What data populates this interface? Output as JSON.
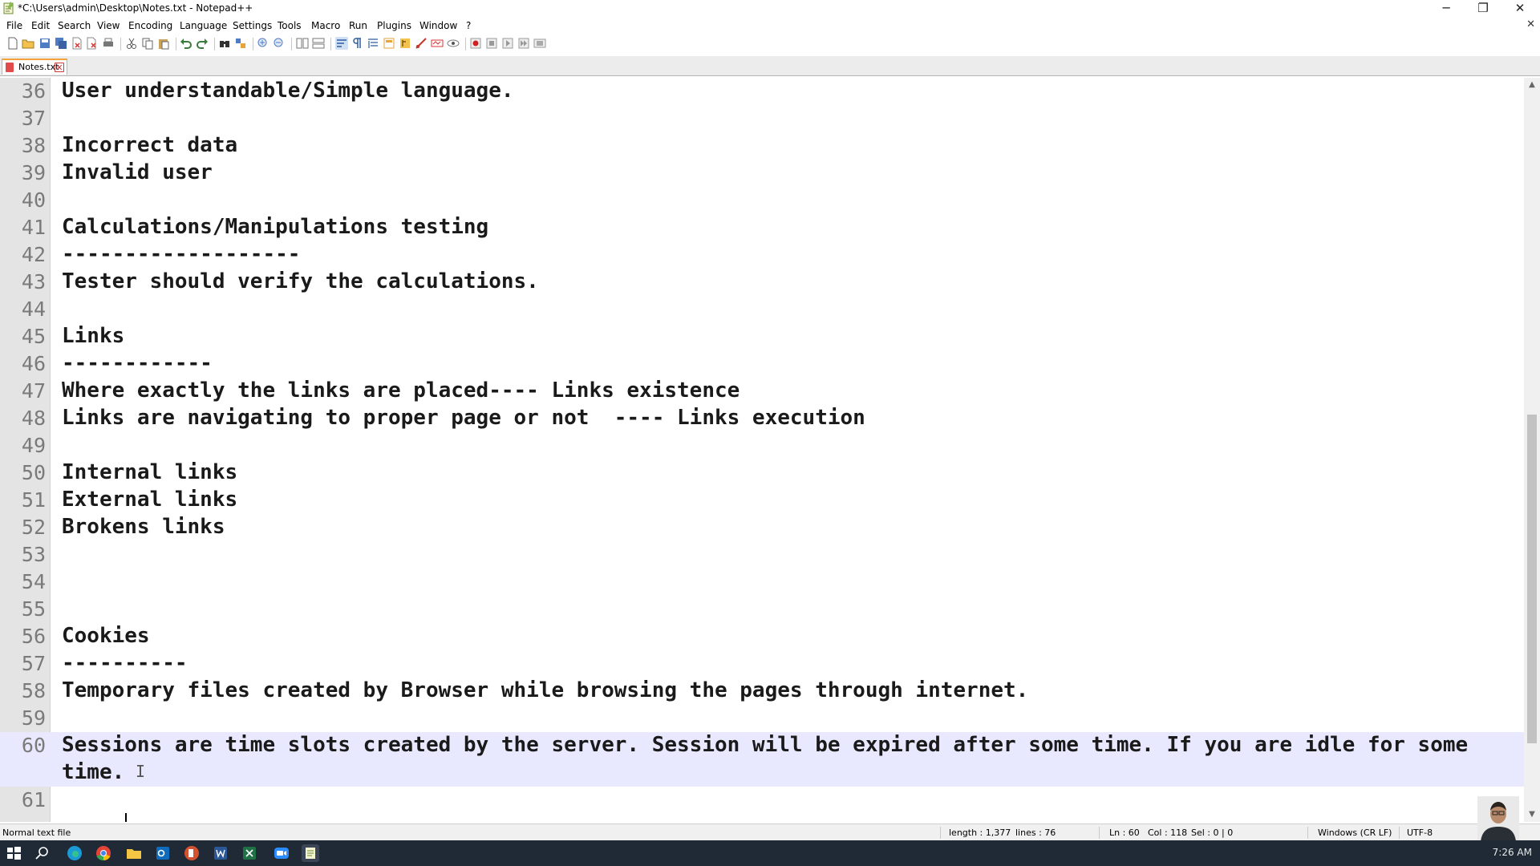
{
  "window": {
    "title": "*C:\\Users\\admin\\Desktop\\Notes.txt - Notepad++",
    "minimize": "─",
    "restore": "❐",
    "close": "✕"
  },
  "menu": {
    "items": [
      "File",
      "Edit",
      "Search",
      "View",
      "Encoding",
      "Language",
      "Settings",
      "Tools",
      "Macro",
      "Run",
      "Plugins",
      "Window",
      "?"
    ],
    "doc_close": "✕"
  },
  "toolbar": {
    "icons": [
      "new-file-icon",
      "open-file-icon",
      "save-icon",
      "save-all-icon",
      "close-icon",
      "close-all-icon",
      "print-icon",
      "cut-icon",
      "copy-icon",
      "paste-icon",
      "undo-icon",
      "redo-icon",
      "find-icon",
      "replace-icon",
      "zoom-in-icon",
      "zoom-out-icon",
      "sync-vertical-icon",
      "sync-horizontal-icon",
      "word-wrap-icon",
      "show-all-chars-icon",
      "indent-guide-icon",
      "doc-map-icon",
      "function-list-icon",
      "folder-workspace-icon",
      "monitoring-icon",
      "record-macro-icon",
      "stop-macro-icon",
      "play-macro-icon",
      "run-macro-multiple-icon",
      "save-macro-icon"
    ]
  },
  "tabs": [
    {
      "label": "Notes.txt",
      "close": "✕"
    }
  ],
  "editor": {
    "lines": [
      {
        "n": "36",
        "text": "User understandable/Simple language."
      },
      {
        "n": "37",
        "text": ""
      },
      {
        "n": "38",
        "text": "Incorrect data"
      },
      {
        "n": "39",
        "text": "Invalid user"
      },
      {
        "n": "40",
        "text": ""
      },
      {
        "n": "41",
        "text": "Calculations/Manipulations testing"
      },
      {
        "n": "42",
        "text": "-------------------"
      },
      {
        "n": "43",
        "text": "Tester should verify the calculations."
      },
      {
        "n": "44",
        "text": ""
      },
      {
        "n": "45",
        "text": "Links"
      },
      {
        "n": "46",
        "text": "------------"
      },
      {
        "n": "47",
        "text": "Where exactly the links are placed---- Links existence"
      },
      {
        "n": "48",
        "text": "Links are navigating to proper page or not  ---- Links execution"
      },
      {
        "n": "49",
        "text": ""
      },
      {
        "n": "50",
        "text": "Internal links"
      },
      {
        "n": "51",
        "text": "External links"
      },
      {
        "n": "52",
        "text": "Brokens links"
      },
      {
        "n": "53",
        "text": ""
      },
      {
        "n": "54",
        "text": ""
      },
      {
        "n": "55",
        "text": ""
      },
      {
        "n": "56",
        "text": "Cookies"
      },
      {
        "n": "57",
        "text": "----------"
      },
      {
        "n": "58",
        "text": "Temporary files created by Browser while browsing the pages through internet."
      },
      {
        "n": "59",
        "text": ""
      },
      {
        "n": "60",
        "text": "Sessions are time slots created by the server. Session will be expired after some time. If you are idle for some",
        "current": true
      },
      {
        "n": "",
        "text": "time.",
        "current": true
      },
      {
        "n": "61",
        "text": ""
      }
    ]
  },
  "status": {
    "file_type": "Normal text file",
    "length": "length : 1,377",
    "lines": "lines : 76",
    "ln": "Ln : 60",
    "col": "Col : 118",
    "sel": "Sel : 0 | 0",
    "eol": "Windows (CR LF)",
    "encoding": "UTF-8"
  },
  "taskbar": {
    "clock": "7:26 AM",
    "apps": [
      "windows-start-icon",
      "search-icon",
      "edge-icon",
      "chrome-icon",
      "file-explorer-icon",
      "outlook-icon",
      "powerpoint-icon",
      "word-icon",
      "excel-icon",
      "zoom-icon",
      "notepadpp-icon"
    ]
  },
  "colors": {
    "current_line": "#e8e8ff",
    "gutter": "#e4e4e4",
    "taskbar": "#1f2a36",
    "tab_accent": "#f3a33a"
  }
}
